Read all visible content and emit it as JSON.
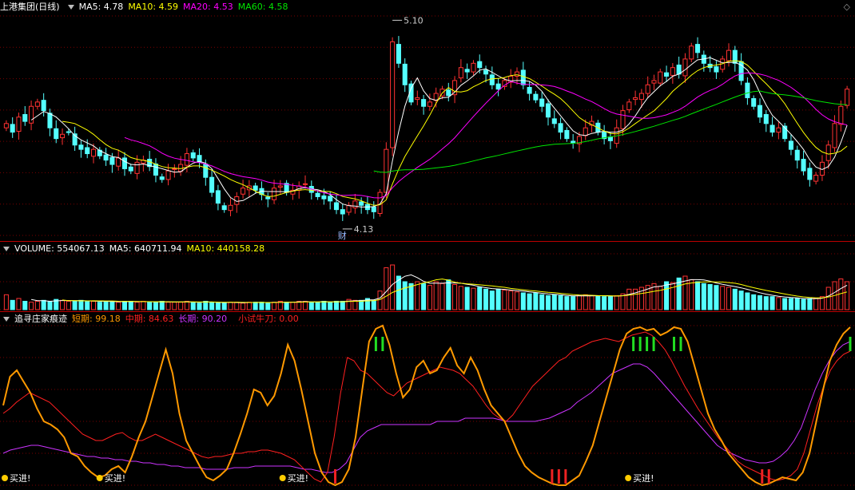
{
  "price_panel": {
    "title": "上港集团(日线)",
    "ma5_label": "MA5: 4.78",
    "ma10_label": "MA10: 4.59",
    "ma20_label": "MA20: 4.53",
    "ma60_label": "MA60: 4.58",
    "high_marker": "5.10",
    "low_marker": "4.13",
    "low_tag": "财"
  },
  "volume_panel": {
    "volume_label": "VOLUME: 554067.13",
    "ma5_label": "MA5: 640711.94",
    "ma10_label": "MA10: 440158.28"
  },
  "indicator_panel": {
    "title": "追寻庄家痕迹",
    "short_label": "短期: 99.18",
    "mid_label": "中期: 84.63",
    "long_label": "长期: 90.20",
    "knife_label": "小试牛刀: 0.00",
    "buy_signal": "买进!"
  },
  "colors": {
    "up": "#ff3232",
    "down": "#54ffff",
    "ma5": "#ffffff",
    "ma10": "#ffff00",
    "ma20": "#ff00ff",
    "ma60": "#00e600",
    "short": "#ff9900",
    "mid": "#ff2020",
    "long": "#cc33ff"
  },
  "chart_data": {
    "type": "candlestick",
    "price": {
      "closes": [
        4.62,
        4.58,
        4.65,
        4.63,
        4.7,
        4.72,
        4.68,
        4.6,
        4.55,
        4.57,
        4.58,
        4.52,
        4.5,
        4.48,
        4.5,
        4.47,
        4.45,
        4.43,
        4.46,
        4.41,
        4.4,
        4.44,
        4.45,
        4.42,
        4.38,
        4.36,
        4.4,
        4.41,
        4.43,
        4.48,
        4.46,
        4.44,
        4.37,
        4.3,
        4.25,
        4.22,
        4.24,
        4.28,
        4.32,
        4.33,
        4.31,
        4.29,
        4.27,
        4.32,
        4.33,
        4.3,
        4.31,
        4.33,
        4.34,
        4.3,
        4.28,
        4.27,
        4.26,
        4.22,
        4.2,
        4.24,
        4.26,
        4.24,
        4.22,
        4.21,
        4.3,
        4.5,
        5.0,
        4.9,
        4.8,
        4.72,
        4.74,
        4.7,
        4.72,
        4.76,
        4.78,
        4.75,
        4.82,
        4.88,
        4.86,
        4.9,
        4.88,
        4.85,
        4.8,
        4.78,
        4.82,
        4.84,
        4.86,
        4.8,
        4.76,
        4.73,
        4.7,
        4.65,
        4.62,
        4.58,
        4.55,
        4.53,
        4.56,
        4.6,
        4.63,
        4.58,
        4.55,
        4.54,
        4.6,
        4.68,
        4.72,
        4.74,
        4.76,
        4.8,
        4.82,
        4.86,
        4.84,
        4.88,
        4.85,
        4.92,
        4.98,
        4.95,
        4.9,
        4.88,
        4.86,
        4.92,
        4.96,
        4.9,
        4.82,
        4.74,
        4.7,
        4.65,
        4.62,
        4.58,
        4.6,
        4.55,
        4.5,
        4.45,
        4.4,
        4.36,
        4.38,
        4.44,
        4.52,
        4.62,
        4.7,
        4.78
      ],
      "ylim": [
        4.1,
        5.12
      ],
      "high": 5.1,
      "low": 4.13
    },
    "volume": {
      "values": [
        16,
        10,
        12,
        9,
        8,
        9,
        10,
        9,
        11,
        10,
        9,
        9,
        10,
        9,
        9,
        8,
        9,
        9,
        8,
        9,
        9,
        8,
        9,
        8,
        8,
        9,
        8,
        8,
        8,
        9,
        8,
        7,
        9,
        8,
        7,
        7,
        8,
        8,
        7,
        8,
        8,
        8,
        7,
        8,
        9,
        8,
        8,
        9,
        9,
        8,
        8,
        9,
        8,
        9,
        9,
        11,
        10,
        10,
        12,
        10,
        20,
        45,
        48,
        36,
        30,
        28,
        30,
        28,
        26,
        30,
        28,
        32,
        27,
        25,
        24,
        23,
        24,
        22,
        20,
        22,
        21,
        20,
        19,
        18,
        17,
        18,
        16,
        15,
        16,
        15,
        14,
        14,
        15,
        16,
        15,
        15,
        14,
        14,
        15,
        17,
        22,
        22,
        24,
        26,
        28,
        25,
        30,
        29,
        34,
        36,
        32,
        30,
        28,
        27,
        26,
        25,
        24,
        22,
        20,
        18,
        16,
        15,
        14,
        14,
        13,
        12,
        12,
        12,
        11,
        12,
        12,
        14,
        24,
        30,
        33,
        30
      ],
      "ylim": [
        0,
        60
      ]
    },
    "indicator": {
      "ylim": [
        0,
        100
      ],
      "short_values": [
        50,
        68,
        72,
        65,
        58,
        48,
        40,
        38,
        35,
        30,
        20,
        18,
        12,
        8,
        5,
        6,
        10,
        12,
        8,
        18,
        30,
        40,
        55,
        70,
        85,
        70,
        45,
        28,
        20,
        12,
        5,
        3,
        6,
        10,
        20,
        32,
        45,
        60,
        58,
        50,
        56,
        70,
        88,
        78,
        60,
        40,
        20,
        8,
        2,
        0,
        2,
        10,
        30,
        60,
        90,
        98,
        100,
        88,
        70,
        55,
        60,
        74,
        78,
        70,
        72,
        80,
        86,
        75,
        70,
        80,
        72,
        60,
        50,
        45,
        40,
        30,
        20,
        12,
        8,
        5,
        3,
        1,
        0,
        0,
        3,
        6,
        15,
        25,
        40,
        55,
        70,
        85,
        95,
        98,
        99,
        97,
        98,
        94,
        96,
        99,
        98,
        90,
        75,
        60,
        45,
        35,
        28,
        20,
        15,
        10,
        5,
        2,
        0,
        1,
        3,
        5,
        4,
        3,
        8,
        20,
        40,
        60,
        78,
        88,
        95,
        99
      ],
      "mid_values": [
        45,
        48,
        52,
        55,
        58,
        56,
        54,
        52,
        48,
        44,
        40,
        36,
        32,
        30,
        28,
        28,
        30,
        32,
        33,
        30,
        28,
        28,
        30,
        32,
        30,
        28,
        26,
        24,
        22,
        20,
        18,
        17,
        18,
        18,
        19,
        20,
        20,
        21,
        21,
        22,
        22,
        21,
        20,
        18,
        16,
        12,
        8,
        4,
        2,
        8,
        30,
        58,
        80,
        78,
        72,
        70,
        66,
        62,
        58,
        56,
        60,
        64,
        66,
        68,
        70,
        72,
        74,
        73,
        72,
        70,
        66,
        62,
        56,
        50,
        45,
        42,
        40,
        44,
        50,
        56,
        62,
        66,
        70,
        74,
        78,
        80,
        84,
        86,
        88,
        90,
        91,
        92,
        91,
        90,
        92,
        94,
        95,
        96,
        94,
        90,
        85,
        78,
        70,
        62,
        55,
        48,
        42,
        36,
        30,
        25,
        20,
        15,
        12,
        10,
        8,
        6,
        4,
        3,
        4,
        6,
        10,
        20,
        35,
        50,
        62,
        72,
        78,
        82,
        84
      ],
      "long_values": [
        20,
        22,
        23,
        24,
        25,
        25,
        24,
        23,
        22,
        21,
        20,
        19,
        18,
        18,
        17,
        17,
        16,
        16,
        15,
        15,
        14,
        14,
        13,
        13,
        12,
        12,
        11,
        11,
        11,
        10,
        10,
        10,
        10,
        11,
        11,
        11,
        12,
        12,
        12,
        12,
        12,
        12,
        11,
        10,
        10,
        9,
        8,
        8,
        10,
        14,
        22,
        30,
        34,
        36,
        38,
        38,
        38,
        38,
        38,
        38,
        38,
        38,
        40,
        40,
        40,
        40,
        42,
        42,
        42,
        42,
        42,
        41,
        40,
        40,
        40,
        40,
        40,
        41,
        42,
        44,
        46,
        48,
        52,
        55,
        58,
        62,
        66,
        70,
        72,
        74,
        76,
        76,
        74,
        70,
        65,
        60,
        55,
        50,
        45,
        40,
        35,
        30,
        25,
        22,
        20,
        18,
        16,
        15,
        14,
        14,
        15,
        18,
        22,
        28,
        36,
        48,
        60,
        70,
        78,
        84,
        88,
        90
      ],
      "buy_signal_indices": [
        0,
        14,
        41,
        92,
        130
      ]
    }
  }
}
